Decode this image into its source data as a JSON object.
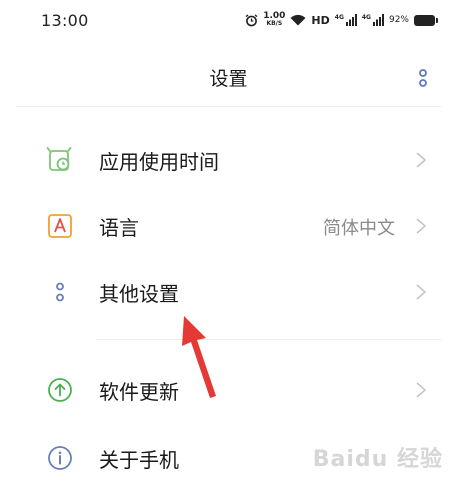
{
  "status_bar": {
    "time": "13:00",
    "net_speed_value": "1.00",
    "net_speed_unit": "KB/S",
    "hd": "HD",
    "sim1_label": "4G",
    "sim2_label": "4G",
    "battery": "92%",
    "icons": [
      "alarm-icon",
      "wifi-icon",
      "signal-icon",
      "battery-icon"
    ]
  },
  "header": {
    "title": "设置",
    "more_icon": "more-dots-icon"
  },
  "settings": {
    "items": [
      {
        "label": "应用使用时间",
        "value": "",
        "icon": "app-usage-timer-icon",
        "icon_color": "#7cc576"
      },
      {
        "label": "语言",
        "value": "简体中文",
        "icon": "language-icon",
        "icon_color": "#f0a030"
      },
      {
        "label": "其他设置",
        "value": "",
        "icon": "more-settings-icon",
        "icon_color": "#6a7fb8"
      },
      {
        "label": "软件更新",
        "value": "",
        "icon": "update-arrow-icon",
        "icon_color": "#4caf50"
      },
      {
        "label": "关于手机",
        "value": "",
        "icon": "info-icon",
        "icon_color": "#6a7fb8"
      }
    ]
  },
  "annotation": {
    "icon": "red-arrow-icon",
    "color": "#e53935"
  },
  "watermark": "Baidu 经验"
}
